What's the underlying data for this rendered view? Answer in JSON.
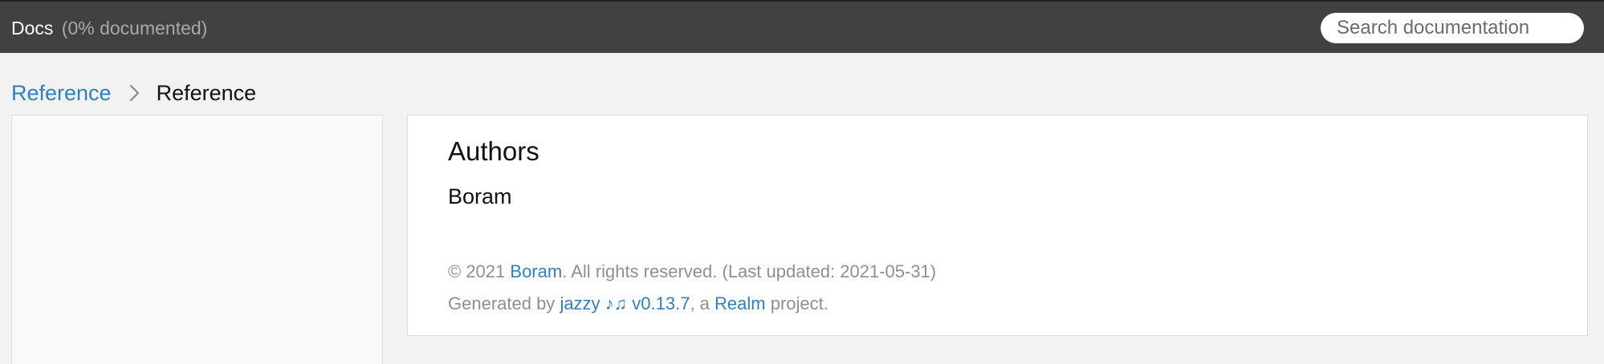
{
  "header": {
    "title": "Docs",
    "coverage": "(0% documented)"
  },
  "search": {
    "placeholder": "Search documentation"
  },
  "breadcrumb": {
    "link_label": "Reference",
    "separator_icon": "chevron-right-icon",
    "current_label": "Reference"
  },
  "main": {
    "heading": "Authors",
    "author": "Boram"
  },
  "footer": {
    "copyright_prefix": "© 2021 ",
    "copyright_link": "Boram",
    "copyright_suffix": ". All rights reserved. (Last updated: 2021-05-31)",
    "generated_prefix": "Generated by ",
    "generator_link": "jazzy ♪♫ v0.13.7",
    "generated_middle": ", a ",
    "realm_link": "Realm",
    "generated_suffix": " project."
  },
  "colors": {
    "header_bg": "#414141",
    "page_bg": "#f2f2f2",
    "link": "#2f7fc1",
    "muted_text": "#8f8f8f"
  }
}
